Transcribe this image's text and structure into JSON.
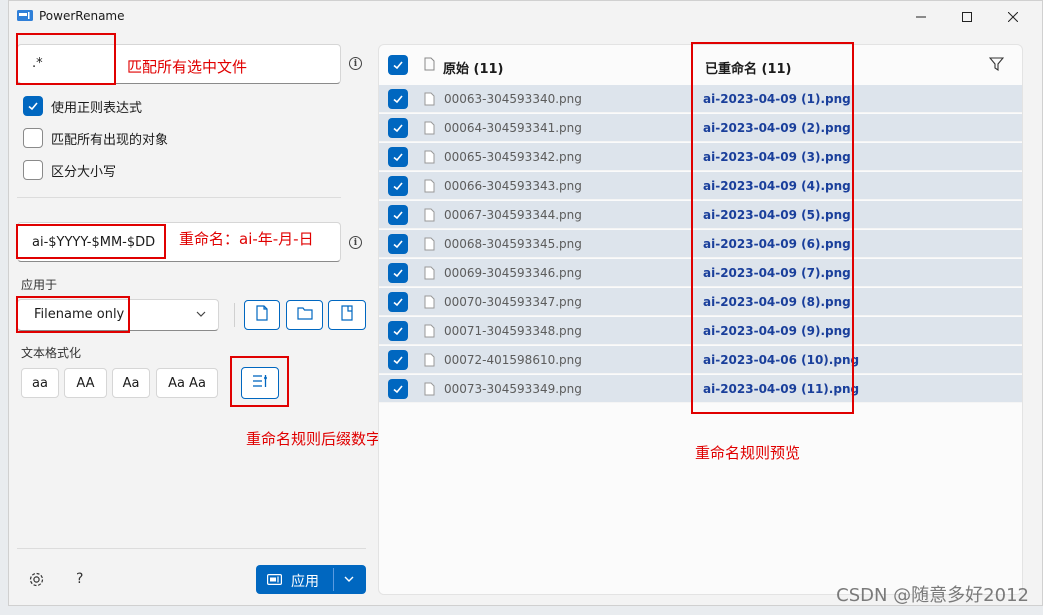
{
  "window": {
    "title": "PowerRename"
  },
  "search": {
    "value": ".*"
  },
  "options": {
    "use_regex": "使用正则表达式",
    "match_all": "匹配所有出现的对象",
    "case_sensitive": "区分大小写"
  },
  "replace": {
    "value": "ai-$YYYY-$MM-$DD"
  },
  "apply_to": {
    "label": "应用于",
    "selected": "Filename only"
  },
  "text_format": {
    "label": "文本格式化",
    "buttons": [
      "aa",
      "AA",
      "Aa",
      "Aa Aa"
    ]
  },
  "footer": {
    "help": "?",
    "apply_label": "应用"
  },
  "list": {
    "original_header": "原始 (11)",
    "renamed_header": "已重命名 (11)",
    "rows": [
      {
        "original": "00063-304593340.png",
        "renamed": "ai-2023-04-09 (1).png"
      },
      {
        "original": "00064-304593341.png",
        "renamed": "ai-2023-04-09 (2).png"
      },
      {
        "original": "00065-304593342.png",
        "renamed": "ai-2023-04-09 (3).png"
      },
      {
        "original": "00066-304593343.png",
        "renamed": "ai-2023-04-09 (4).png"
      },
      {
        "original": "00067-304593344.png",
        "renamed": "ai-2023-04-09 (5).png"
      },
      {
        "original": "00068-304593345.png",
        "renamed": "ai-2023-04-09 (6).png"
      },
      {
        "original": "00069-304593346.png",
        "renamed": "ai-2023-04-09 (7).png"
      },
      {
        "original": "00070-304593347.png",
        "renamed": "ai-2023-04-09 (8).png"
      },
      {
        "original": "00071-304593348.png",
        "renamed": "ai-2023-04-09 (9).png"
      },
      {
        "original": "00072-401598610.png",
        "renamed": "ai-2023-04-06 (10).png"
      },
      {
        "original": "00073-304593349.png",
        "renamed": "ai-2023-04-09 (11).png"
      }
    ]
  },
  "annotations": {
    "search_note": "匹配所有选中文件",
    "rename_note": "重命名：ai-年-月-日",
    "enumerate_note": "重命名规则后缀数字",
    "preview_note": "重命名规则预览"
  },
  "watermark": "CSDN @随意多好2012",
  "colors": {
    "accent": "#0067c0",
    "annotation": "#e00000",
    "renamed_text": "#1a3f9b"
  }
}
